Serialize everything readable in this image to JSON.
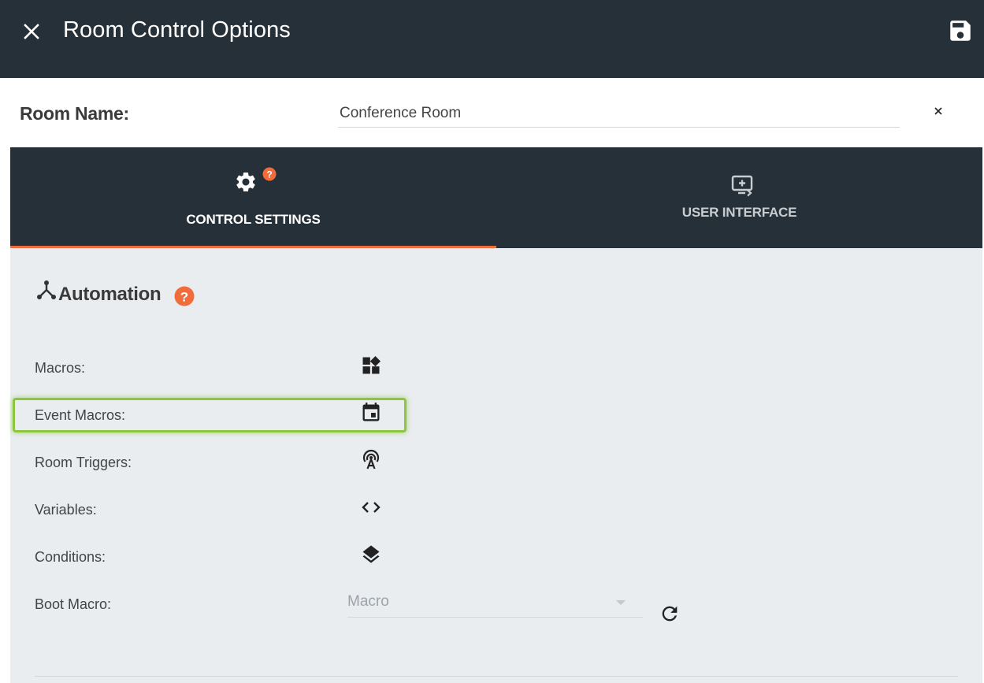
{
  "header": {
    "title": "Room Control Options",
    "close_icon": "close-icon",
    "save_icon": "save-icon"
  },
  "room": {
    "label": "Room Name:",
    "value": "Conference Room",
    "clear_symbol": "×"
  },
  "tabs": [
    {
      "label": "CONTROL SETTINGS",
      "icon": "gear-icon",
      "help_badge": "?",
      "active": true
    },
    {
      "label": "USER INTERFACE",
      "icon": "monitor-add-icon",
      "active": false
    }
  ],
  "automation": {
    "title": "Automation",
    "title_icon": "hub-icon",
    "help_icon": "help-circle-icon",
    "rows": [
      {
        "label": "Macros:",
        "icon": "widgets-icon"
      },
      {
        "label": "Event Macros:",
        "icon": "calendar-event-icon"
      },
      {
        "label": "Room Triggers:",
        "icon": "antenna-icon"
      },
      {
        "label": "Variables:",
        "icon": "code-icon"
      },
      {
        "label": "Conditions:",
        "icon": "layers-icon"
      }
    ],
    "boot_macro": {
      "label": "Boot Macro:",
      "placeholder": "Macro",
      "refresh_icon": "refresh-icon"
    }
  },
  "colors": {
    "header_bg": "#263038",
    "accent": "#f26b3a",
    "panel_bg": "#e9edf0",
    "highlight": "#8cc63f"
  }
}
